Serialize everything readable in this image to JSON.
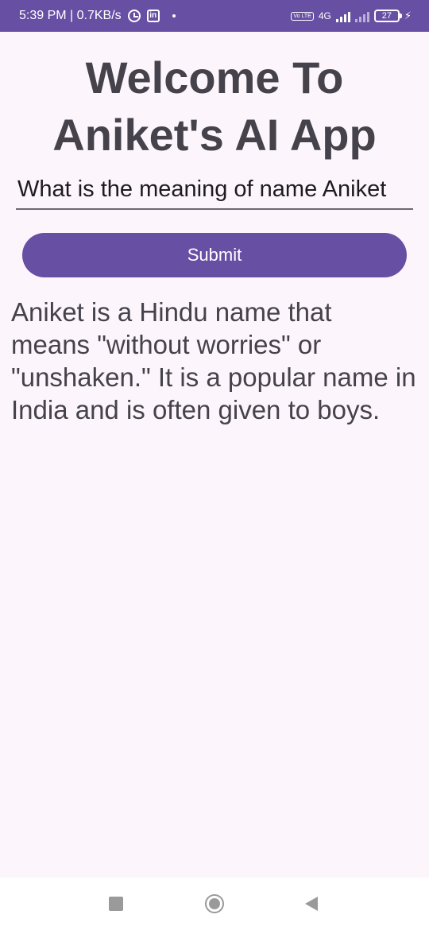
{
  "status_bar": {
    "time_speed": "5:39 PM | 0.7KB/s",
    "linkedin_label": "in",
    "volte_label": "Vo LTE",
    "network_label": "4G",
    "battery_level": "27",
    "icons": [
      "alarm-icon",
      "linkedin-icon",
      "signal-icon",
      "battery-icon",
      "charging-icon"
    ]
  },
  "page": {
    "title": "Welcome To Aniket's AI App"
  },
  "query": {
    "value": "What is the meaning of name Aniket"
  },
  "submit": {
    "label": "Submit"
  },
  "response": {
    "text": "Aniket is a Hindu name that means \"without worries\" or \"unshaken.\" It is a popular name in India and is often given to boys."
  },
  "navigation": {
    "icons": [
      "recents-icon",
      "home-icon",
      "back-icon"
    ]
  },
  "colors": {
    "primary": "#6750a4",
    "background": "#fcf6fc",
    "text": "#45424b"
  }
}
